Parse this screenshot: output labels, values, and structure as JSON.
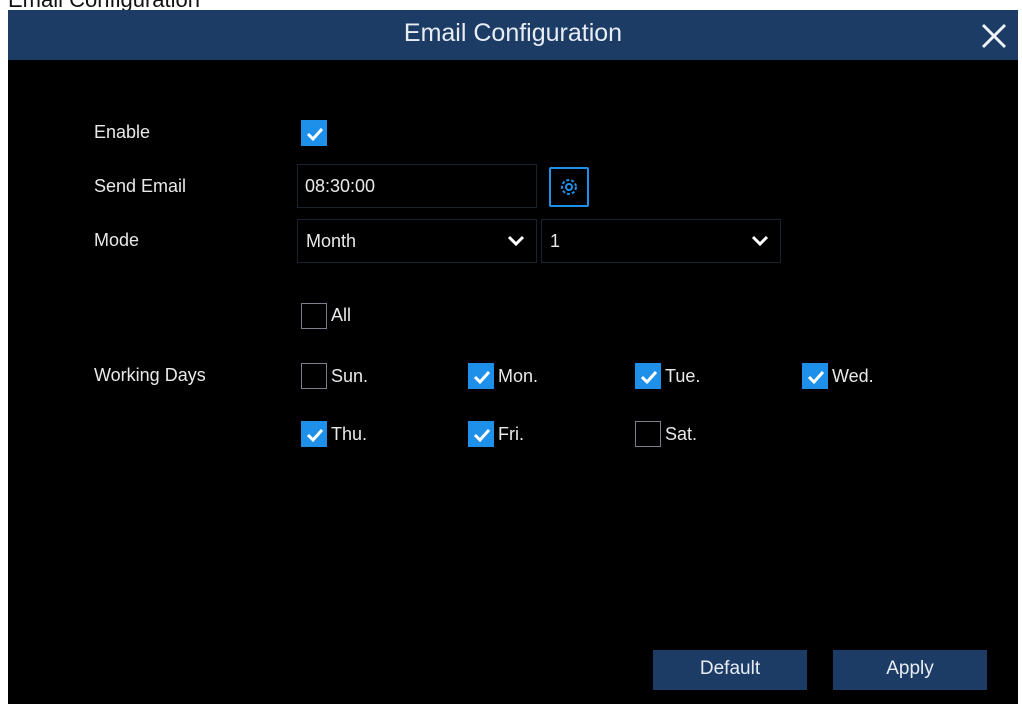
{
  "partial_top_text": "Email Configuration",
  "dialog": {
    "title": "Email Configuration",
    "close_icon": "close-icon"
  },
  "form": {
    "enable": {
      "label": "Enable",
      "checked": true
    },
    "send_email": {
      "label": "Send Email",
      "value": "08:30:00",
      "settings_icon": "gear-icon"
    },
    "mode": {
      "label": "Mode",
      "mode_value": "Month",
      "day_value": "1"
    },
    "all": {
      "label": "All",
      "checked": false
    },
    "working_days": {
      "label": "Working Days",
      "days": [
        {
          "label": "Sun.",
          "checked": false
        },
        {
          "label": "Mon.",
          "checked": true
        },
        {
          "label": "Tue.",
          "checked": true
        },
        {
          "label": "Wed.",
          "checked": true
        },
        {
          "label": "Thu.",
          "checked": true
        },
        {
          "label": "Fri.",
          "checked": true
        },
        {
          "label": "Sat.",
          "checked": false
        }
      ]
    }
  },
  "buttons": {
    "default_label": "Default",
    "apply_label": "Apply"
  },
  "colors": {
    "accent": "#1f90ea",
    "titlebar": "#1c3c66",
    "background": "#000000"
  }
}
